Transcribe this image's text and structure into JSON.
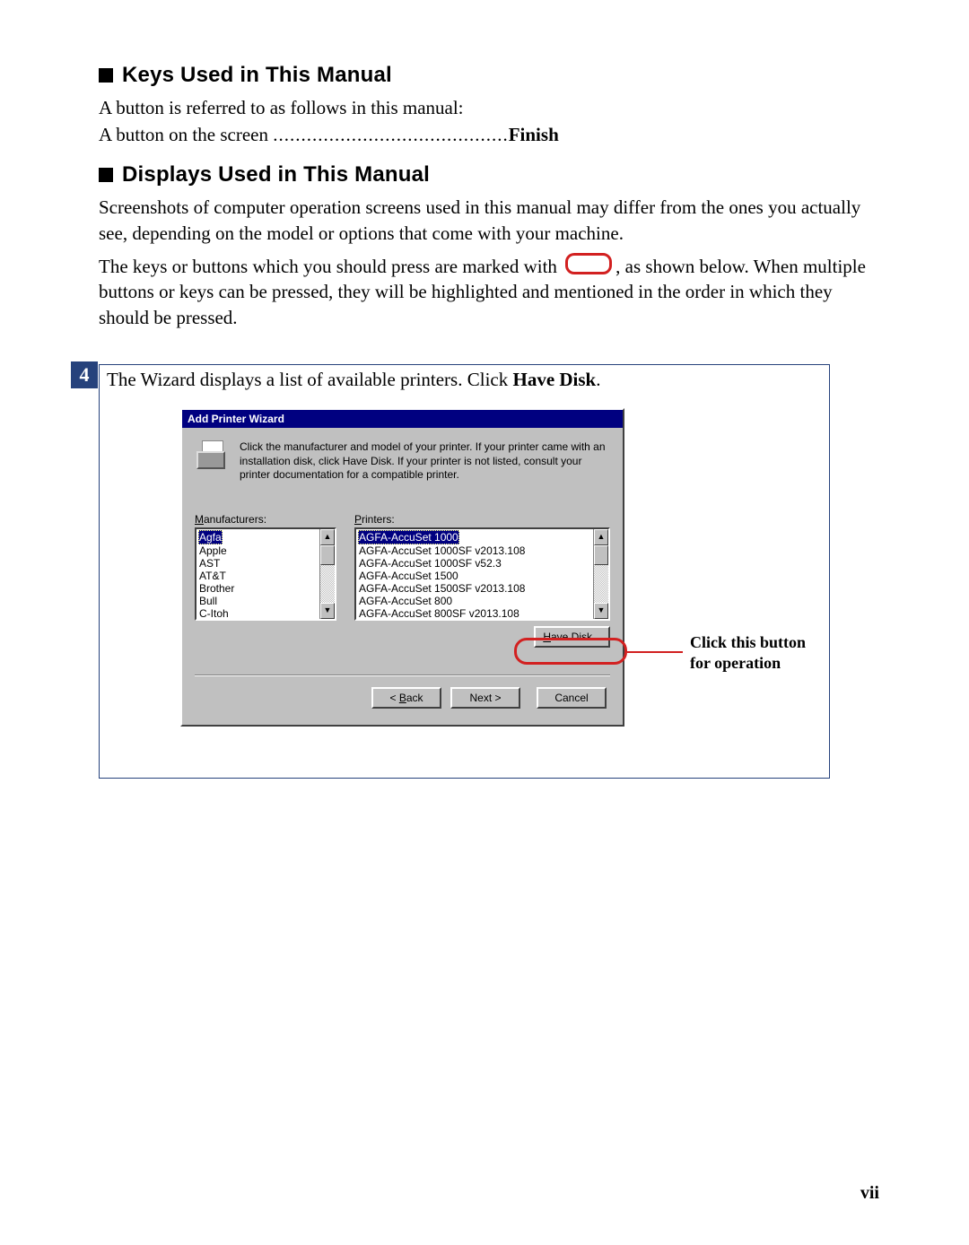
{
  "section1": {
    "title": "Keys Used in This Manual",
    "p1": "A button is referred to as follows in this manual:",
    "line_left": "A button on the screen ",
    "dots": "..........................................",
    "line_right": "Finish"
  },
  "section2": {
    "title": "Displays Used in This Manual",
    "p1": "Screenshots of computer operation screens used in this manual may differ from the ones you actually see, depending on the model or options that come with your machine.",
    "p2a": "The keys or buttons which you should press are marked with ",
    "p2b": ", as shown below. When multiple buttons or keys can be pressed, they will be highlighted and mentioned in the order in which they should be pressed."
  },
  "figure": {
    "step_num": "4",
    "step_desc_a": "The Wizard displays a list of available printers. Click ",
    "step_desc_b": "Have Disk",
    "step_desc_c": ".",
    "dialog": {
      "title": "Add Printer Wizard",
      "instruction": "Click the manufacturer and model of your printer. If your printer came with an installation disk, click Have Disk. If your printer is not listed, consult your printer documentation for a compatible printer.",
      "manu_label_u": "M",
      "manu_label_rest": "anufacturers:",
      "prn_label_u": "P",
      "prn_label_rest": "rinters:",
      "manufacturers": [
        "Agfa",
        "Apple",
        "AST",
        "AT&T",
        "Brother",
        "Bull",
        "C-Itoh"
      ],
      "printers": [
        "AGFA-AccuSet 1000",
        "AGFA-AccuSet 1000SF v2013.108",
        "AGFA-AccuSet 1000SF v52.3",
        "AGFA-AccuSet 1500",
        "AGFA-AccuSet 1500SF v2013.108",
        "AGFA-AccuSet 800",
        "AGFA-AccuSet 800SF v2013.108"
      ],
      "have_disk_u": "H",
      "have_disk_rest": "ave Disk...",
      "back_lt": "< ",
      "back_u": "B",
      "back_rest": "ack",
      "next": "Next >",
      "cancel": "Cancel"
    },
    "callout_l1": "Click this button",
    "callout_l2": "for operation"
  },
  "page_num": "vii"
}
